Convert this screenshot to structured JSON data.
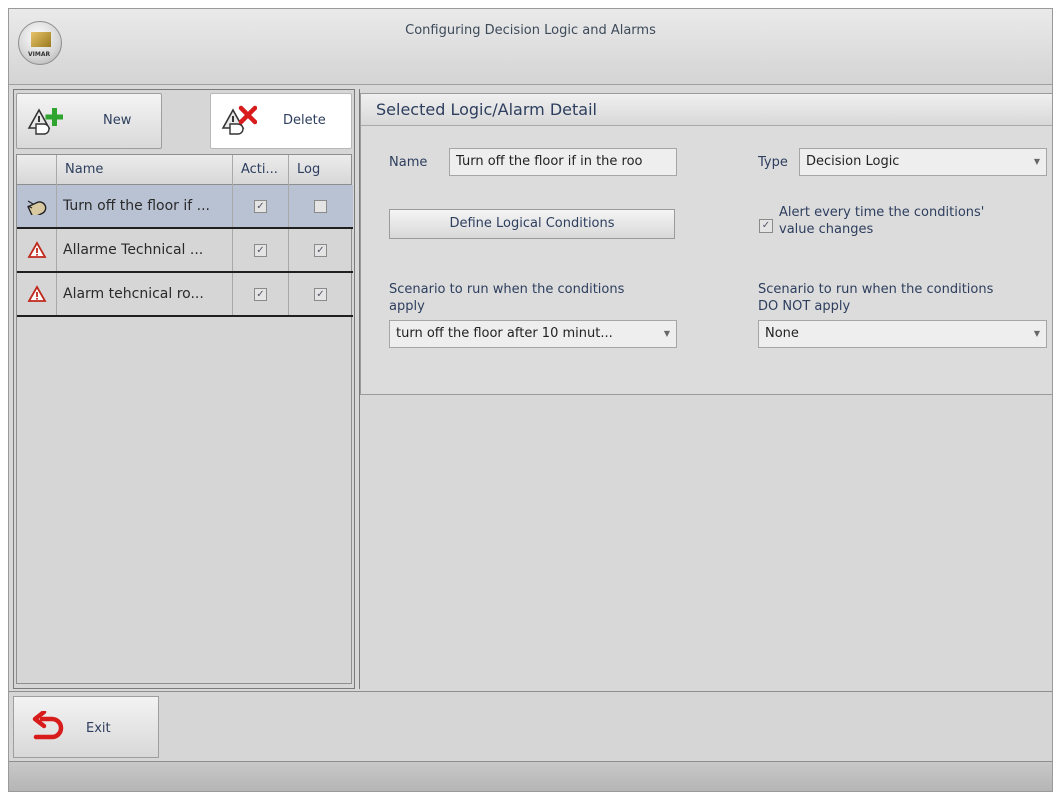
{
  "window": {
    "title": "Configuring Decision Logic and Alarms",
    "app_logo_text": "VIMAR"
  },
  "toolbar": {
    "new_label": "New",
    "delete_label": "Delete"
  },
  "grid": {
    "columns": [
      "Name",
      "Acti...",
      "Log"
    ],
    "rows": [
      {
        "icon": "decision-logic-icon",
        "name": "Turn off the floor if ...",
        "active": true,
        "log": false,
        "selected": true
      },
      {
        "icon": "alarm-warning-icon",
        "name": "Allarme Technical ...",
        "active": true,
        "log": true,
        "selected": false
      },
      {
        "icon": "alarm-warning-icon",
        "name": "Alarm tehcnical ro...",
        "active": true,
        "log": true,
        "selected": false
      }
    ]
  },
  "detail": {
    "title": "Selected Logic/Alarm Detail",
    "name_label": "Name",
    "name_value": "Turn off the floor if in the roo",
    "type_label": "Type",
    "type_value": "Decision Logic",
    "define_button": "Define Logical Conditions",
    "alert_checked": true,
    "alert_line1": "Alert every time the conditions'",
    "alert_line2": "value changes",
    "scenario_apply_line1": "Scenario to run when the conditions",
    "scenario_apply_line2": "apply",
    "scenario_apply_value": "turn off the floor after 10 minut...",
    "scenario_notapply_line1": "Scenario to run when the conditions",
    "scenario_notapply_line2": "DO NOT apply",
    "scenario_notapply_value": "None"
  },
  "footer": {
    "exit_label": "Exit"
  },
  "colors": {
    "accent_text": "#2d3e5e",
    "selected_row": "#b9c2d3",
    "add_green": "#2fa52f",
    "delete_red": "#d81b1b",
    "alarm_red": "#c0281c"
  }
}
